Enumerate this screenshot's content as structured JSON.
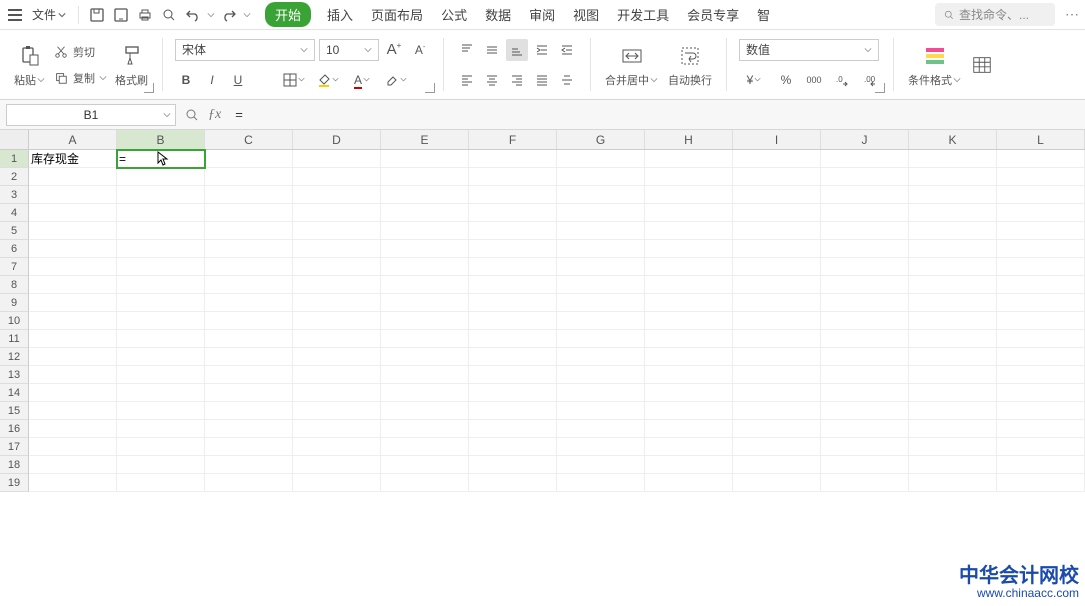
{
  "menu": {
    "file_label": "文件",
    "search_placeholder": "查找命令、..."
  },
  "tabs": [
    "开始",
    "插入",
    "页面布局",
    "公式",
    "数据",
    "审阅",
    "视图",
    "开发工具",
    "会员专享",
    "智"
  ],
  "active_tab_index": 0,
  "ribbon": {
    "paste_label": "粘贴",
    "cut_label": "剪切",
    "copy_label": "复制",
    "format_painter_label": "格式刷",
    "font_name": "宋体",
    "font_size": "10",
    "merge_center_label": "合并居中",
    "wrap_text_label": "自动换行",
    "number_format_label": "数值",
    "currency_symbol": "¥",
    "percent_symbol": "%",
    "thousands_symbol": "000",
    "cond_format_label": "条件格式"
  },
  "formula_bar": {
    "name_box": "B1",
    "formula": "="
  },
  "grid": {
    "columns": [
      "A",
      "B",
      "C",
      "D",
      "E",
      "F",
      "G",
      "H",
      "I",
      "J",
      "K",
      "L"
    ],
    "row_count": 19,
    "active_cell": "B1",
    "cells": {
      "A1": "库存现金",
      "B1": "="
    }
  },
  "watermark": {
    "line1": "中华会计网校",
    "line2": "www.chinaacc.com"
  }
}
